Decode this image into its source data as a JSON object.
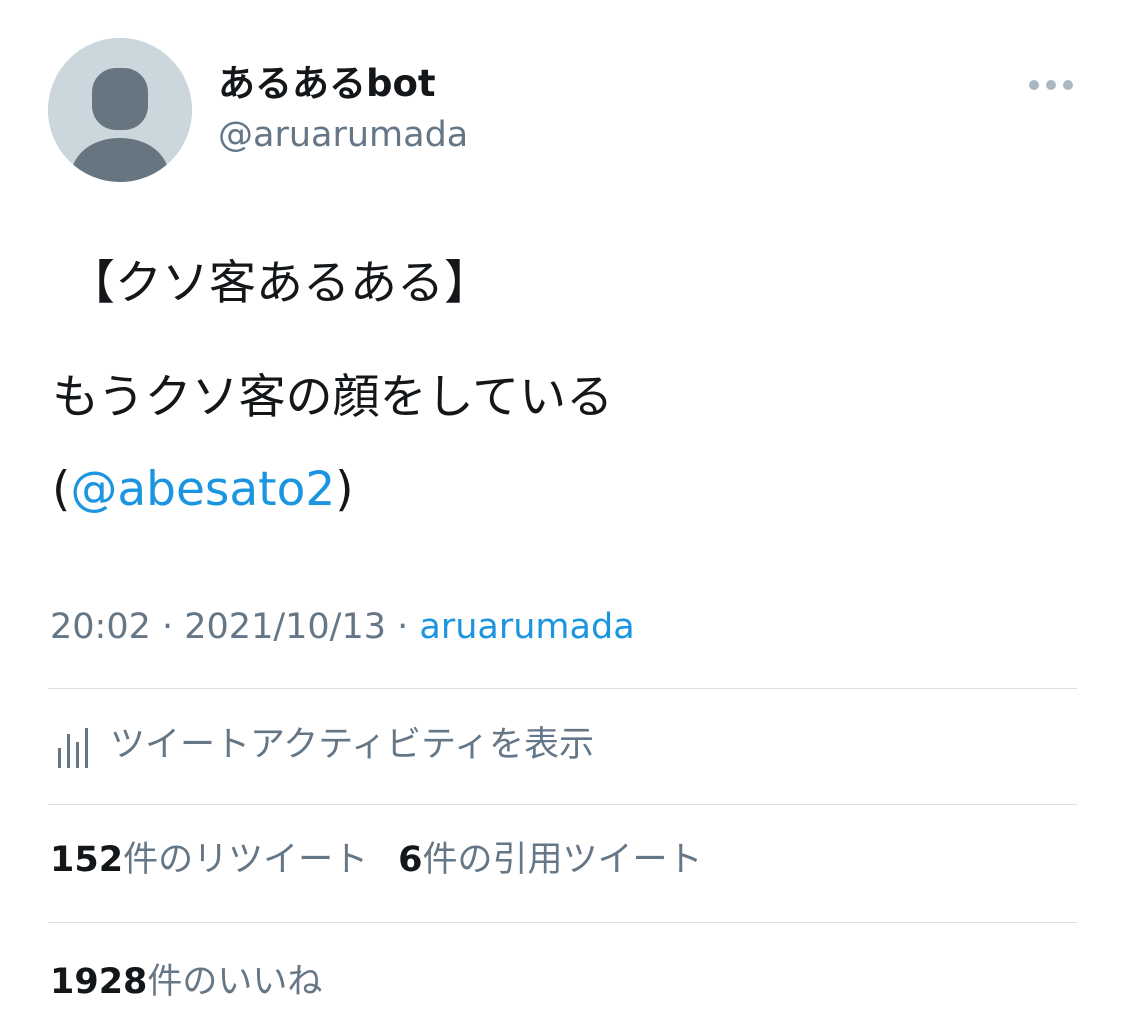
{
  "author": {
    "display_name": "あるあるbot",
    "handle": "@aruarumada",
    "avatar_icon": "default-user-avatar-icon"
  },
  "more_icon": "more-horizontal-icon",
  "tweet": {
    "line1": "【クソ客あるある】",
    "line2": "もうクソ客の顔をしている",
    "paren_open": "(",
    "mention": "@abesato2",
    "paren_close": ")"
  },
  "meta": {
    "time": "20:02",
    "sep1": " · ",
    "date": "2021/10/13",
    "sep2": " · ",
    "source": "aruarumada"
  },
  "activity": {
    "icon": "bar-chart-icon",
    "label": "ツイートアクティビティを表示"
  },
  "stats": {
    "retweets_count": "152",
    "retweets_label": "件のリツイート",
    "quotes_count": "6",
    "quotes_label": "件の引用ツイート",
    "likes_count": "1928",
    "likes_label": "件のいいね"
  },
  "colors": {
    "text_primary": "#14171a",
    "text_secondary": "#657786",
    "link": "#1b95e0",
    "divider": "#d9e1e8",
    "avatar_bg": "#ccd6dd",
    "avatar_fg": "#657786"
  }
}
